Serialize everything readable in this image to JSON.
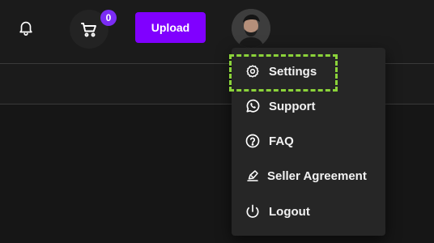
{
  "header": {
    "notifications_icon": "bell-icon",
    "cart": {
      "icon": "cart-icon",
      "count": "0",
      "badge_color": "#7b2cf5"
    },
    "upload_label": "Upload",
    "upload_color": "#8000ff",
    "avatar_icon": "user-avatar"
  },
  "profile_menu": {
    "items": [
      {
        "label": "Settings",
        "icon": "gear-icon"
      },
      {
        "label": "Support",
        "icon": "whatsapp-icon"
      },
      {
        "label": "FAQ",
        "icon": "question-circle-icon"
      },
      {
        "label": "Seller Agreement",
        "icon": "pen-agreement-icon"
      },
      {
        "label": "Logout",
        "icon": "power-icon"
      }
    ],
    "highlight_color": "#8bd33a"
  }
}
